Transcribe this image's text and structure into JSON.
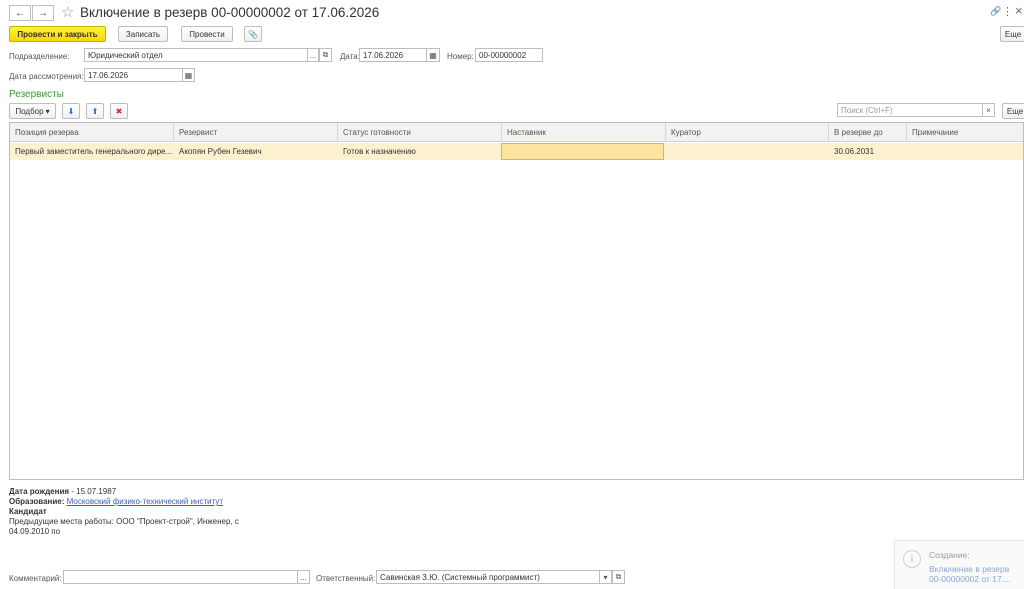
{
  "window": {
    "title": "Включение в резерв 00-00000002 от 17.06.2026",
    "back_glyph": "←",
    "forward_glyph": "→",
    "star_glyph": "☆",
    "link_glyph": "🔗",
    "menu_glyph": "⋮",
    "close_glyph": "×"
  },
  "toolbar": {
    "post_close": "Провести и закрыть",
    "save": "Записать",
    "post": "Провести",
    "attach_glyph": "📎",
    "more": "Еще"
  },
  "form": {
    "department_label": "Подразделение:",
    "department_value": "Юридический отдел",
    "date_label": "Дата:",
    "date_value": "17.06.2026",
    "number_label": "Номер:",
    "number_value": "00-00000002",
    "review_date_label": "Дата рассмотрения:",
    "review_date_value": "17.06.2026",
    "dots": "...",
    "open_glyph": "⧉",
    "calendar_glyph": "▦"
  },
  "reservists": {
    "title": "Резервисты",
    "pick": "Подбор",
    "pick_arrow": "▾",
    "down_glyph": "⬇",
    "up_glyph": "⬆",
    "delete_glyph": "✖",
    "search_placeholder": "Поиск (Ctrl+F)",
    "clear_glyph": "×",
    "more": "Еще",
    "columns": [
      "Позиция резерва",
      "Резервист",
      "Статус готовности",
      "Наставник",
      "Куратор",
      "В резерве до",
      "Примечание"
    ],
    "rows": [
      [
        "Первый заместитель генерального дире...",
        "Акопян Рубен Гезевич",
        "Готов к назначению",
        "",
        "",
        "30.06.2031",
        ""
      ]
    ]
  },
  "details": {
    "birth_label": "Дата рождения",
    "birth_value": " - 15.07.1987",
    "education_label": "Образование:",
    "education_value": "Московский физико-технический институт",
    "candidate": "Кандидат",
    "prev_jobs_line1": "Предыдущие места работы: ООО \"Проект-строй\", Инженер, с",
    "prev_jobs_line2": "04.09.2010 по"
  },
  "footer": {
    "comment_label": "Комментарий:",
    "comment_value": "",
    "dots": "...",
    "responsible_label": "Ответственный:",
    "responsible_value": "Савинская З.Ю. (Системный программист)",
    "dropdown_glyph": "▾",
    "open_glyph": "⧉"
  },
  "notification": {
    "icon_glyph": "i",
    "title": "Создание:",
    "line1": "Включение в резерв",
    "line2": "00-00000002 от 17...."
  }
}
